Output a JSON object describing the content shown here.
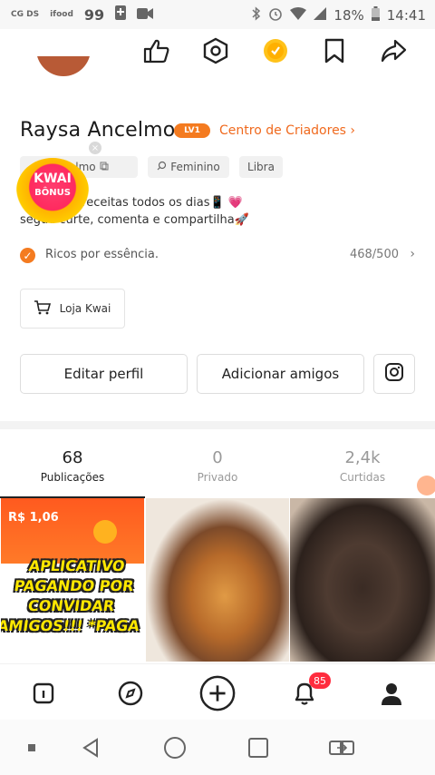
{
  "status_bar": {
    "left_small": "CG\nDS",
    "left_small2": "ifood",
    "number": "99",
    "battery_text": "18%",
    "time": "14:41"
  },
  "profile": {
    "name": "Raysa Ancelmo",
    "level_badge": "LV1",
    "creators_link": "Centro de Criadores ›",
    "tags": {
      "username": "ancelmo",
      "gender": "Feminino",
      "zodiac": "Libra"
    },
    "bio_line1": "e receitas todos os dias📱 💗",
    "bio_line2": "segue curte, comenta e compartilha🚀",
    "ricos_text": "Ricos por essência.",
    "ricos_count": "468/500",
    "kwai_bonus_line1": "KWAI",
    "kwai_bonus_line2": "BÔNUS"
  },
  "buttons": {
    "shop": "Loja Kwai",
    "edit_profile": "Editar perfil",
    "add_friends": "Adicionar amigos"
  },
  "stats": [
    {
      "value": "68",
      "label": "Publicações"
    },
    {
      "value": "0",
      "label": "Privado"
    },
    {
      "value": "2,4k",
      "label": "Curtidas"
    }
  ],
  "thumbnails": {
    "t1_price": "R$ 1,06",
    "t1_overlay": "APLICATIVO PAGANDO POR CONVIDAR AMIGOS!!! *PAGA"
  },
  "tabbar": {
    "notification_count": "85"
  },
  "colors": {
    "accent": "#f06a1e",
    "badge_red": "#ff2c3e"
  }
}
